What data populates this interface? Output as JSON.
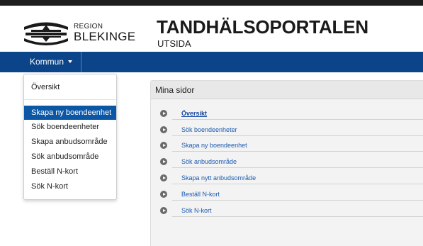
{
  "logo": {
    "region": "REGION",
    "name": "BLEKINGE"
  },
  "header": {
    "title": "TANDHÄLSOPORTALEN",
    "subtitle": "UTSIDA"
  },
  "nav": {
    "kommun_label": "Kommun"
  },
  "dropdown": {
    "items": [
      {
        "label": "Översikt"
      },
      {
        "label": "Skapa ny boendeenhet",
        "active": true
      },
      {
        "label": "Sök boendeenheter"
      },
      {
        "label": "Skapa anbudsområde"
      },
      {
        "label": "Sök anbudsområde"
      },
      {
        "label": "Beställ N-kort"
      },
      {
        "label": "Sök N-kort"
      }
    ]
  },
  "panel": {
    "title": "Mina sidor",
    "links": [
      {
        "label": "Översikt"
      },
      {
        "label": "Sök boendeenheter"
      },
      {
        "label": "Skapa ny boendeenhet"
      },
      {
        "label": "Sök anbudsområde"
      },
      {
        "label": "Skapa nytt anbudsområde"
      },
      {
        "label": "Beställ N-kort"
      },
      {
        "label": "Sök N-kort"
      }
    ]
  },
  "colors": {
    "nav": "#0b4488",
    "active_item": "#0b57a6",
    "link": "#1a5ab0",
    "topbar": "#1e1e1e"
  }
}
